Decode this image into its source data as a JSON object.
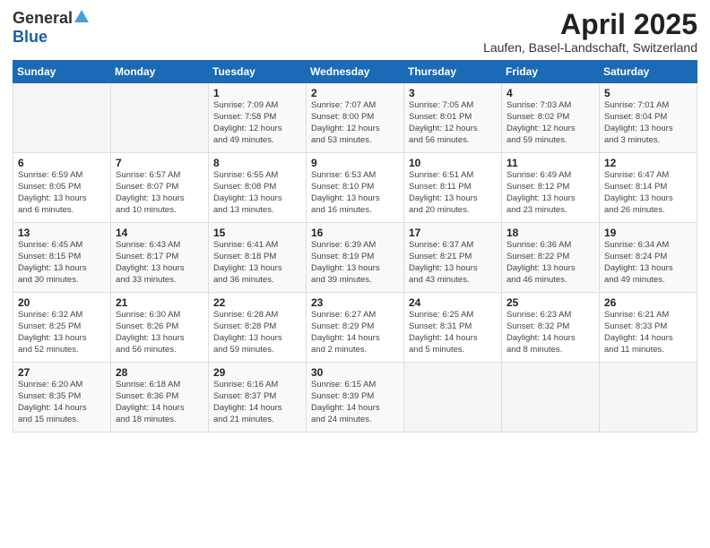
{
  "logo": {
    "general": "General",
    "blue": "Blue"
  },
  "header": {
    "title": "April 2025",
    "location": "Laufen, Basel-Landschaft, Switzerland"
  },
  "weekdays": [
    "Sunday",
    "Monday",
    "Tuesday",
    "Wednesday",
    "Thursday",
    "Friday",
    "Saturday"
  ],
  "weeks": [
    [
      {
        "day": "",
        "info": ""
      },
      {
        "day": "",
        "info": ""
      },
      {
        "day": "1",
        "info": "Sunrise: 7:09 AM\nSunset: 7:58 PM\nDaylight: 12 hours\nand 49 minutes."
      },
      {
        "day": "2",
        "info": "Sunrise: 7:07 AM\nSunset: 8:00 PM\nDaylight: 12 hours\nand 53 minutes."
      },
      {
        "day": "3",
        "info": "Sunrise: 7:05 AM\nSunset: 8:01 PM\nDaylight: 12 hours\nand 56 minutes."
      },
      {
        "day": "4",
        "info": "Sunrise: 7:03 AM\nSunset: 8:02 PM\nDaylight: 12 hours\nand 59 minutes."
      },
      {
        "day": "5",
        "info": "Sunrise: 7:01 AM\nSunset: 8:04 PM\nDaylight: 13 hours\nand 3 minutes."
      }
    ],
    [
      {
        "day": "6",
        "info": "Sunrise: 6:59 AM\nSunset: 8:05 PM\nDaylight: 13 hours\nand 6 minutes."
      },
      {
        "day": "7",
        "info": "Sunrise: 6:57 AM\nSunset: 8:07 PM\nDaylight: 13 hours\nand 10 minutes."
      },
      {
        "day": "8",
        "info": "Sunrise: 6:55 AM\nSunset: 8:08 PM\nDaylight: 13 hours\nand 13 minutes."
      },
      {
        "day": "9",
        "info": "Sunrise: 6:53 AM\nSunset: 8:10 PM\nDaylight: 13 hours\nand 16 minutes."
      },
      {
        "day": "10",
        "info": "Sunrise: 6:51 AM\nSunset: 8:11 PM\nDaylight: 13 hours\nand 20 minutes."
      },
      {
        "day": "11",
        "info": "Sunrise: 6:49 AM\nSunset: 8:12 PM\nDaylight: 13 hours\nand 23 minutes."
      },
      {
        "day": "12",
        "info": "Sunrise: 6:47 AM\nSunset: 8:14 PM\nDaylight: 13 hours\nand 26 minutes."
      }
    ],
    [
      {
        "day": "13",
        "info": "Sunrise: 6:45 AM\nSunset: 8:15 PM\nDaylight: 13 hours\nand 30 minutes."
      },
      {
        "day": "14",
        "info": "Sunrise: 6:43 AM\nSunset: 8:17 PM\nDaylight: 13 hours\nand 33 minutes."
      },
      {
        "day": "15",
        "info": "Sunrise: 6:41 AM\nSunset: 8:18 PM\nDaylight: 13 hours\nand 36 minutes."
      },
      {
        "day": "16",
        "info": "Sunrise: 6:39 AM\nSunset: 8:19 PM\nDaylight: 13 hours\nand 39 minutes."
      },
      {
        "day": "17",
        "info": "Sunrise: 6:37 AM\nSunset: 8:21 PM\nDaylight: 13 hours\nand 43 minutes."
      },
      {
        "day": "18",
        "info": "Sunrise: 6:36 AM\nSunset: 8:22 PM\nDaylight: 13 hours\nand 46 minutes."
      },
      {
        "day": "19",
        "info": "Sunrise: 6:34 AM\nSunset: 8:24 PM\nDaylight: 13 hours\nand 49 minutes."
      }
    ],
    [
      {
        "day": "20",
        "info": "Sunrise: 6:32 AM\nSunset: 8:25 PM\nDaylight: 13 hours\nand 52 minutes."
      },
      {
        "day": "21",
        "info": "Sunrise: 6:30 AM\nSunset: 8:26 PM\nDaylight: 13 hours\nand 56 minutes."
      },
      {
        "day": "22",
        "info": "Sunrise: 6:28 AM\nSunset: 8:28 PM\nDaylight: 13 hours\nand 59 minutes."
      },
      {
        "day": "23",
        "info": "Sunrise: 6:27 AM\nSunset: 8:29 PM\nDaylight: 14 hours\nand 2 minutes."
      },
      {
        "day": "24",
        "info": "Sunrise: 6:25 AM\nSunset: 8:31 PM\nDaylight: 14 hours\nand 5 minutes."
      },
      {
        "day": "25",
        "info": "Sunrise: 6:23 AM\nSunset: 8:32 PM\nDaylight: 14 hours\nand 8 minutes."
      },
      {
        "day": "26",
        "info": "Sunrise: 6:21 AM\nSunset: 8:33 PM\nDaylight: 14 hours\nand 11 minutes."
      }
    ],
    [
      {
        "day": "27",
        "info": "Sunrise: 6:20 AM\nSunset: 8:35 PM\nDaylight: 14 hours\nand 15 minutes."
      },
      {
        "day": "28",
        "info": "Sunrise: 6:18 AM\nSunset: 8:36 PM\nDaylight: 14 hours\nand 18 minutes."
      },
      {
        "day": "29",
        "info": "Sunrise: 6:16 AM\nSunset: 8:37 PM\nDaylight: 14 hours\nand 21 minutes."
      },
      {
        "day": "30",
        "info": "Sunrise: 6:15 AM\nSunset: 8:39 PM\nDaylight: 14 hours\nand 24 minutes."
      },
      {
        "day": "",
        "info": ""
      },
      {
        "day": "",
        "info": ""
      },
      {
        "day": "",
        "info": ""
      }
    ]
  ]
}
